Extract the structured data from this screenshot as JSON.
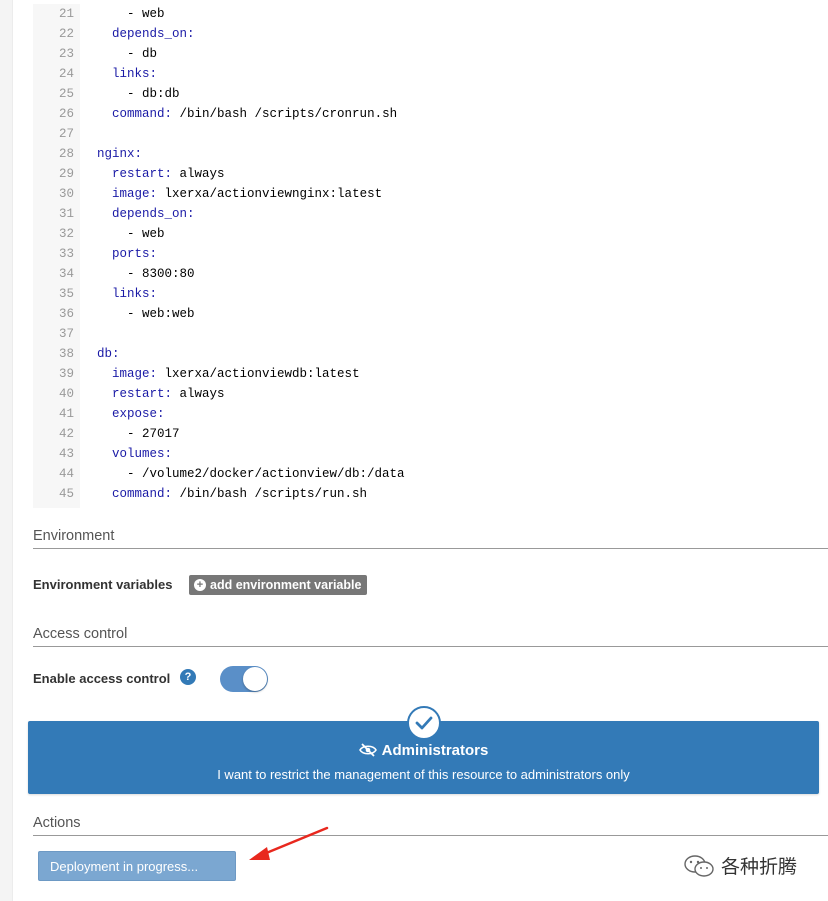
{
  "editor": {
    "lines": [
      {
        "n": "21",
        "indent": "    ",
        "key": "",
        "rest": "- web"
      },
      {
        "n": "22",
        "indent": "  ",
        "key": "depends_on:",
        "rest": ""
      },
      {
        "n": "23",
        "indent": "    ",
        "key": "",
        "rest": "- db"
      },
      {
        "n": "24",
        "indent": "  ",
        "key": "links:",
        "rest": ""
      },
      {
        "n": "25",
        "indent": "    ",
        "key": "",
        "rest": "- db:db"
      },
      {
        "n": "26",
        "indent": "  ",
        "key": "command:",
        "rest": " /bin/bash /scripts/cronrun.sh"
      },
      {
        "n": "27",
        "indent": "",
        "key": "",
        "rest": ""
      },
      {
        "n": "28",
        "indent": "",
        "key": "nginx:",
        "rest": ""
      },
      {
        "n": "29",
        "indent": "  ",
        "key": "restart:",
        "rest": " always"
      },
      {
        "n": "30",
        "indent": "  ",
        "key": "image:",
        "rest": " lxerxa/actionviewnginx:latest"
      },
      {
        "n": "31",
        "indent": "  ",
        "key": "depends_on:",
        "rest": ""
      },
      {
        "n": "32",
        "indent": "    ",
        "key": "",
        "rest": "- web"
      },
      {
        "n": "33",
        "indent": "  ",
        "key": "ports:",
        "rest": ""
      },
      {
        "n": "34",
        "indent": "    ",
        "key": "",
        "rest": "- 8300:80"
      },
      {
        "n": "35",
        "indent": "  ",
        "key": "links:",
        "rest": ""
      },
      {
        "n": "36",
        "indent": "    ",
        "key": "",
        "rest": "- web:web"
      },
      {
        "n": "37",
        "indent": "",
        "key": "",
        "rest": ""
      },
      {
        "n": "38",
        "indent": "",
        "key": "db:",
        "rest": ""
      },
      {
        "n": "39",
        "indent": "  ",
        "key": "image:",
        "rest": " lxerxa/actionviewdb:latest"
      },
      {
        "n": "40",
        "indent": "  ",
        "key": "restart:",
        "rest": " always"
      },
      {
        "n": "41",
        "indent": "  ",
        "key": "expose:",
        "rest": ""
      },
      {
        "n": "42",
        "indent": "    ",
        "key": "",
        "rest": "- 27017"
      },
      {
        "n": "43",
        "indent": "  ",
        "key": "volumes:",
        "rest": ""
      },
      {
        "n": "44",
        "indent": "    ",
        "key": "",
        "rest": "- /volume2/docker/actionview/db:/data"
      },
      {
        "n": "45",
        "indent": "  ",
        "key": "command:",
        "rest": " /bin/bash /scripts/run.sh"
      }
    ]
  },
  "environment": {
    "title": "Environment",
    "variables_label": "Environment variables",
    "add_button": "add environment variable"
  },
  "access_control": {
    "title": "Access control",
    "enable_label": "Enable access control",
    "enabled": true,
    "admin_title": "Administrators",
    "admin_desc": "I want to restrict the management of this resource to administrators only"
  },
  "actions": {
    "title": "Actions",
    "deploy_button": "Deployment in progress..."
  },
  "watermark": {
    "text": "各种折腾"
  },
  "colors": {
    "primary": "#337ab7",
    "disabled_button": "#7ba7d1",
    "arrow": "#e8281e"
  }
}
